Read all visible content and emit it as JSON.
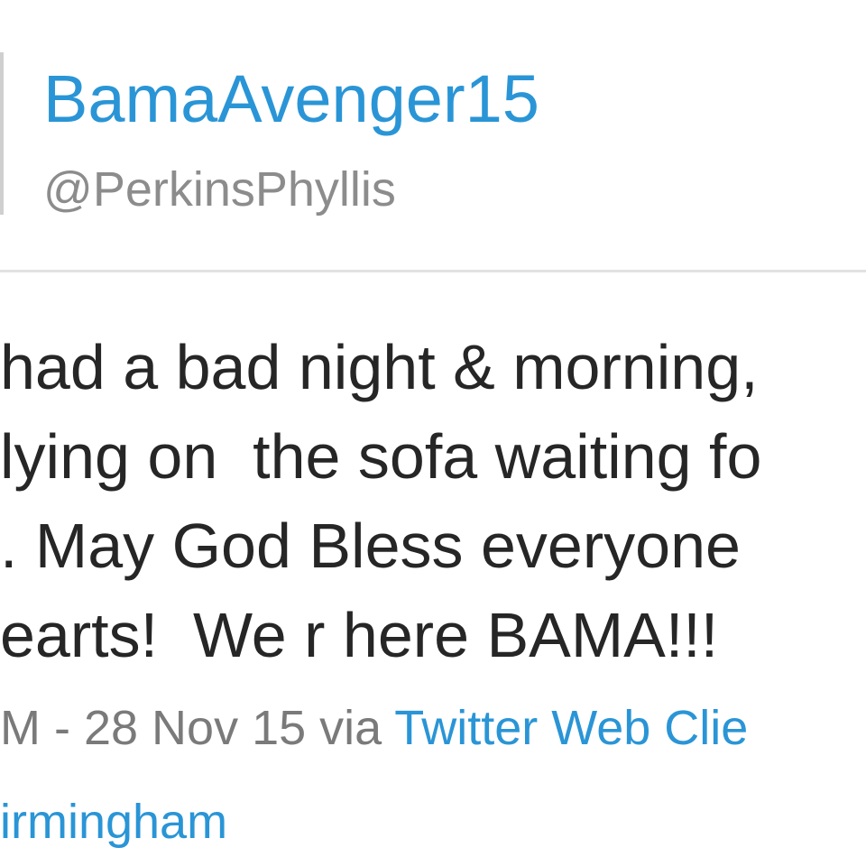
{
  "profile": {
    "display_name": "BamaAvenger15",
    "handle": "@PerkinsPhyllis"
  },
  "tweet": {
    "lines": [
      "had a bad night & morning,",
      "lying on  the sofa waiting fo",
      ". May God Bless everyone",
      "earts!  We r here BAMA!!!"
    ],
    "timestamp": "M - 28 Nov 15 via ",
    "client": "Twitter Web Clie",
    "location": "irmingham"
  },
  "colors": {
    "link": "#2a95d6",
    "text": "#262626",
    "muted": "#7a7a7a"
  }
}
